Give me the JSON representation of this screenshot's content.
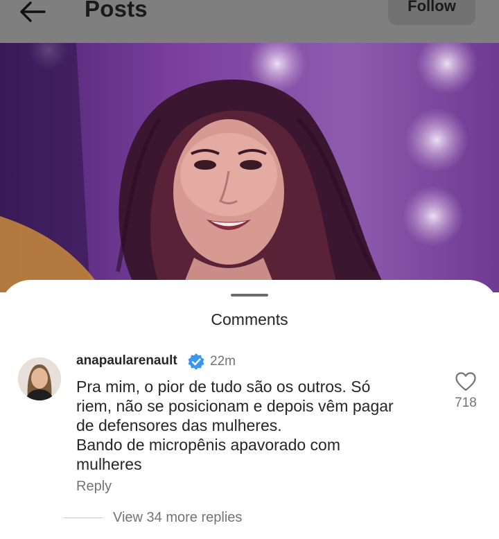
{
  "header": {
    "title": "Posts",
    "back_icon": "arrow-left-icon",
    "follow_label": "Follow"
  },
  "post": {
    "image_icon": "performer-photo"
  },
  "comments_sheet": {
    "title": "Comments",
    "comment": {
      "username": "anapaularenault",
      "verified_icon": "verified-badge-icon",
      "time": "22m",
      "lines": [
        "Pra mim, o pior de tudo são os outros. Só",
        "riem, não se posicionam e depois vêm pagar",
        "de defensores das mulheres.",
        "Bando de micropênis apavorado com",
        "mulheres"
      ],
      "like_count": "718",
      "reply_label": "Reply",
      "view_replies_label": "View 34 more replies"
    }
  },
  "colors": {
    "header_dim": "#7f7f7f",
    "photo_purple": "#6c2f8f",
    "verified_blue": "#3897f0",
    "muted_text": "#737373"
  }
}
